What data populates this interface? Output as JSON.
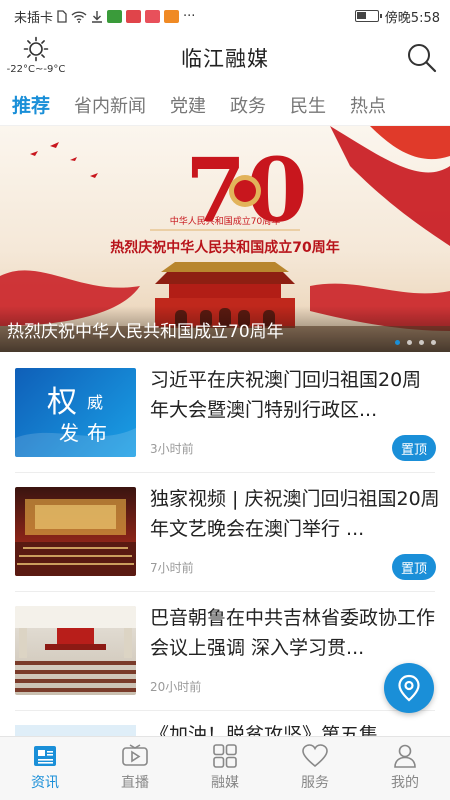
{
  "status_bar": {
    "carrier": "未插卡",
    "more": "···",
    "time": "傍晚5:58"
  },
  "header": {
    "title": "临江融媒",
    "weather_temp": "-22°C~-9°C",
    "weather_icon": "sun-icon",
    "search_icon": "search-icon"
  },
  "tabs": [
    {
      "label": "推荐",
      "active": true
    },
    {
      "label": "省内新闻"
    },
    {
      "label": "党建"
    },
    {
      "label": "政务"
    },
    {
      "label": "民生"
    },
    {
      "label": "热点"
    }
  ],
  "banner": {
    "caption": "热烈庆祝中华人民共和国成立70周年",
    "poster_number": "70",
    "poster_line1": "中华人民共和国成立70周年",
    "poster_line2": "热烈庆祝中华人民共和国成立70周年",
    "slide_count": 4,
    "active_slide": 1
  },
  "news": [
    {
      "headline": "习近平在庆祝澳门回归祖国20周年大会暨澳门特别行政区...",
      "time": "3小时前",
      "pin": "置顶",
      "thumb_text_1": "权",
      "thumb_text_2": "威",
      "thumb_text_3": "发",
      "thumb_text_4": "布"
    },
    {
      "headline": "独家视频 | 庆祝澳门回归祖国20周年文艺晚会在澳门举行 ...",
      "time": "7小时前",
      "pin": "置顶"
    },
    {
      "headline": "巴音朝鲁在中共吉林省委政协工作会议上强调 深入学习贯...",
      "time": "20小时前"
    }
  ],
  "partial_item": {
    "headline": "《加油！脱贫攻坚》第五集"
  },
  "bottom_nav": [
    {
      "label": "资讯",
      "icon": "news-icon",
      "active": true
    },
    {
      "label": "直播",
      "icon": "live-tv-icon"
    },
    {
      "label": "融媒",
      "icon": "grid-icon"
    },
    {
      "label": "服务",
      "icon": "heart-icon"
    },
    {
      "label": "我的",
      "icon": "user-icon"
    }
  ],
  "colors": {
    "accent": "#1a8fd8",
    "banner_red": "#c8161d",
    "banner_gold": "#e2b35a"
  }
}
